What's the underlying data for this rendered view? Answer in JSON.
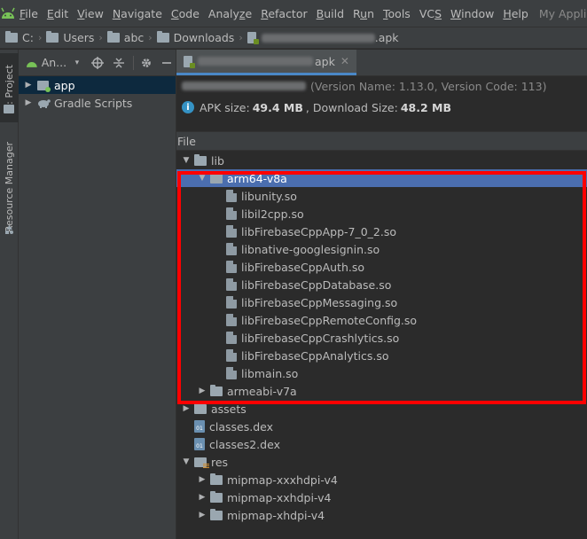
{
  "menubar": {
    "items": [
      "File",
      "Edit",
      "View",
      "Navigate",
      "Code",
      "Analyze",
      "Refactor",
      "Build",
      "Run",
      "Tools",
      "VCS",
      "Window",
      "Help"
    ],
    "mnemonics": [
      "F",
      "E",
      "V",
      "N",
      "C",
      "z",
      "R",
      "B",
      "u",
      "T",
      "S",
      "W",
      "H"
    ],
    "window_title": "My Applicati"
  },
  "breadcrumb": {
    "items": [
      "C:",
      "Users",
      "abc",
      "Downloads"
    ],
    "file_suffix": ".apk"
  },
  "left_strip": {
    "project_tab": "1: Project",
    "resource_manager_tab": "Resource Manager"
  },
  "project_panel": {
    "title": "An...",
    "tree": [
      {
        "label": "app",
        "expanded": false,
        "selected": true
      },
      {
        "label": "Gradle Scripts",
        "expanded": false,
        "selected": false
      }
    ]
  },
  "editor": {
    "tab_suffix": "apk",
    "version_info": "(Version Name: 1.13.0, Version Code: 113)",
    "apk_size_label": "APK size:",
    "apk_size": "49.4 MB",
    "download_size_label": ", Download Size:",
    "download_size": "48.2 MB",
    "column_header": "File"
  },
  "tree": [
    {
      "label": "lib",
      "kind": "folder",
      "arrow": "expanded",
      "depth": 0
    },
    {
      "label": "arm64-v8a",
      "kind": "folder",
      "arrow": "expanded",
      "depth": 1,
      "selected": true
    },
    {
      "label": "libunity.so",
      "kind": "file",
      "arrow": "none",
      "depth": 2
    },
    {
      "label": "libil2cpp.so",
      "kind": "file",
      "arrow": "none",
      "depth": 2
    },
    {
      "label": "libFirebaseCppApp-7_0_2.so",
      "kind": "file",
      "arrow": "none",
      "depth": 2
    },
    {
      "label": "libnative-googlesignin.so",
      "kind": "file",
      "arrow": "none",
      "depth": 2
    },
    {
      "label": "libFirebaseCppAuth.so",
      "kind": "file",
      "arrow": "none",
      "depth": 2
    },
    {
      "label": "libFirebaseCppDatabase.so",
      "kind": "file",
      "arrow": "none",
      "depth": 2
    },
    {
      "label": "libFirebaseCppMessaging.so",
      "kind": "file",
      "arrow": "none",
      "depth": 2
    },
    {
      "label": "libFirebaseCppRemoteConfig.so",
      "kind": "file",
      "arrow": "none",
      "depth": 2
    },
    {
      "label": "libFirebaseCppCrashlytics.so",
      "kind": "file",
      "arrow": "none",
      "depth": 2
    },
    {
      "label": "libFirebaseCppAnalytics.so",
      "kind": "file",
      "arrow": "none",
      "depth": 2
    },
    {
      "label": "libmain.so",
      "kind": "file",
      "arrow": "none",
      "depth": 2
    },
    {
      "label": "armeabi-v7a",
      "kind": "folder",
      "arrow": "collapsed",
      "depth": 1
    },
    {
      "label": "assets",
      "kind": "folder",
      "arrow": "collapsed",
      "depth": 0
    },
    {
      "label": "classes.dex",
      "kind": "dex",
      "arrow": "none",
      "depth": 0
    },
    {
      "label": "classes2.dex",
      "kind": "dex",
      "arrow": "none",
      "depth": 0
    },
    {
      "label": "res",
      "kind": "res",
      "arrow": "expanded",
      "depth": 0
    },
    {
      "label": "mipmap-xxxhdpi-v4",
      "kind": "folder",
      "arrow": "collapsed",
      "depth": 1
    },
    {
      "label": "mipmap-xxhdpi-v4",
      "kind": "folder",
      "arrow": "collapsed",
      "depth": 1
    },
    {
      "label": "mipmap-xhdpi-v4",
      "kind": "folder",
      "arrow": "collapsed",
      "depth": 1
    }
  ],
  "colors": {
    "background": "#2b2b2b",
    "panel": "#3c3f41",
    "selection": "#4b6eaf",
    "highlight_box": "#ff0000",
    "info_icon": "#3592c4"
  }
}
